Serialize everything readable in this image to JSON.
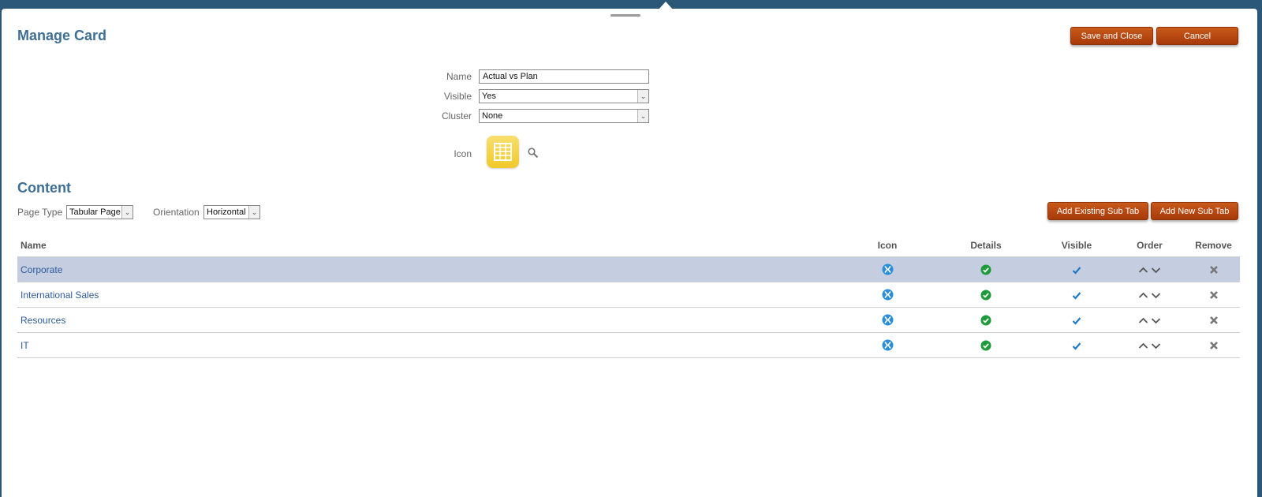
{
  "dialog": {
    "title": "Manage Card",
    "save_close_label": "Save and Close",
    "cancel_label": "Cancel"
  },
  "form": {
    "name_label": "Name",
    "name_value": "Actual vs Plan",
    "visible_label": "Visible",
    "visible_value": "Yes",
    "cluster_label": "Cluster",
    "cluster_value": "None",
    "icon_label": "Icon",
    "icon_name": "table-grid-icon"
  },
  "content": {
    "title": "Content",
    "page_type_label": "Page Type",
    "page_type_value": "Tabular Page",
    "orientation_label": "Orientation",
    "orientation_value": "Horizontal",
    "add_existing_label": "Add Existing Sub Tab",
    "add_new_label": "Add New Sub Tab"
  },
  "table": {
    "columns": [
      "Name",
      "Icon",
      "Details",
      "Visible",
      "Order",
      "Remove"
    ],
    "rows": [
      {
        "name": "Corporate",
        "selected": true
      },
      {
        "name": "International Sales",
        "selected": false
      },
      {
        "name": "Resources",
        "selected": false
      },
      {
        "name": "IT",
        "selected": false
      }
    ]
  },
  "colors": {
    "accent_button": "#b2410d",
    "title_blue": "#3f6f95",
    "selected_row": "#c5cde0",
    "details_green": "#1e9a3a",
    "icon_blue": "#2a8fd8"
  }
}
